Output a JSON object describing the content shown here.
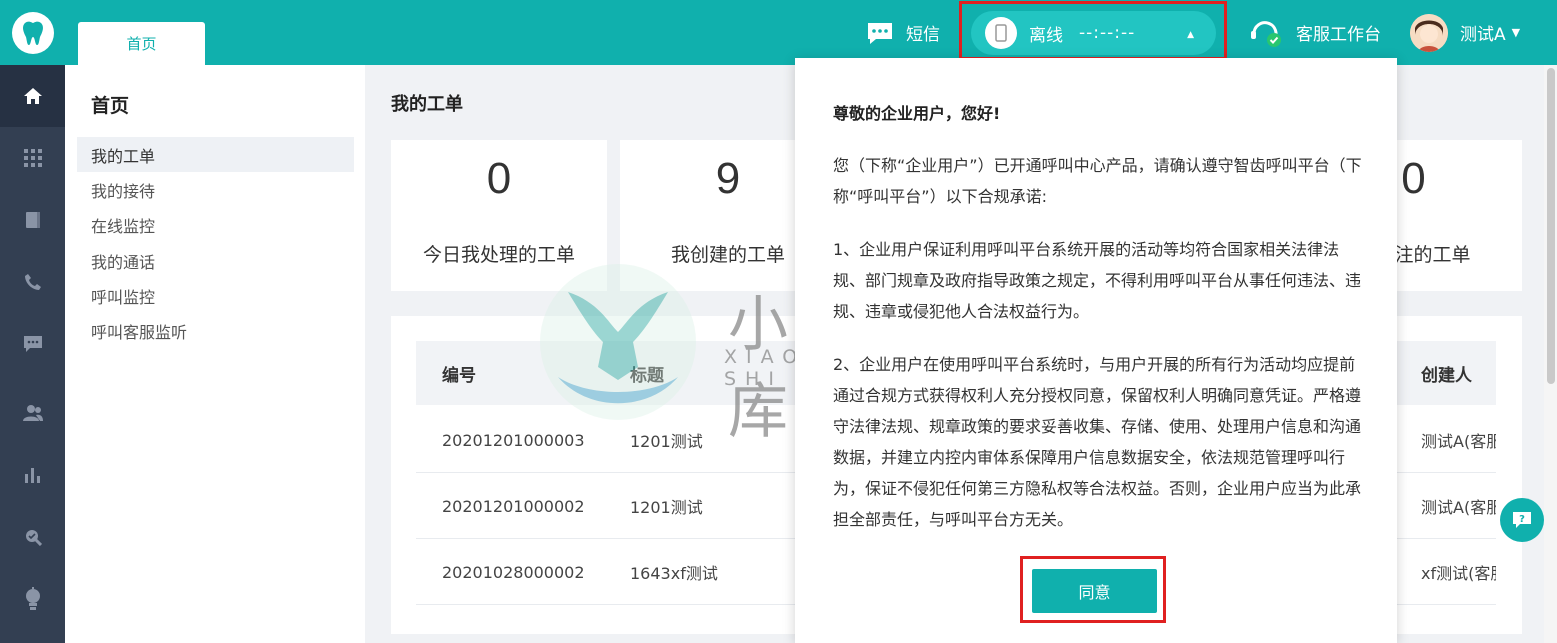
{
  "header": {
    "home_tab": "首页",
    "sms_label": "短信",
    "status_label": "离线",
    "status_time": "--:--:--",
    "workbench_label": "客服工作台",
    "user_name": "测试A"
  },
  "sidebar": {
    "title": "首页",
    "items": [
      "我的工单",
      "我的接待",
      "在线监控",
      "我的通话",
      "呼叫监控",
      "呼叫客服监听"
    ]
  },
  "main": {
    "title": "我的工单",
    "cards": [
      {
        "value": "0",
        "label": "今日我处理的工单"
      },
      {
        "value": "9",
        "label": "我创建的工单"
      },
      {
        "value": "0",
        "label": "我关注的工单"
      }
    ],
    "table": {
      "col_id": "编号",
      "col_title": "标题",
      "col_creator": "创建人",
      "rows": [
        {
          "id": "20201201000003",
          "title": "1201测试",
          "creator": "测试A(客服"
        },
        {
          "id": "20201201000002",
          "title": "1201测试",
          "creator": "测试A(客服"
        },
        {
          "id": "20201028000002",
          "title": "1643xf测试",
          "creator": "xf测试(客服"
        }
      ]
    }
  },
  "modal": {
    "title": "尊敬的企业用户，您好!",
    "p1": "您（下称“企业用户”）已开通呼叫中心产品，请确认遵守智齿呼叫平台（下称“呼叫平台”）以下合规承诺:",
    "p2": "1、企业用户保证利用呼叫平台系统开展的活动等均符合国家相关法律法规、部门规章及政府指导政策之规定，不得利用呼叫平台从事任何违法、违规、违章或侵犯他人合法权益行为。",
    "p3": "2、企业用户在使用呼叫平台系统时，与用户开展的所有行为活动均应提前通过合规方式获得权利人充分授权同意，保留权利人明确同意凭证。严格遵守法律法规、规章政策的要求妥善收集、存储、使用、处理用户信息和沟通数据，并建立内控内审体系保障用户信息数据安全，依法规范管理呼叫行为，保证不侵犯任何第三方隐私权等合法权益。否则，企业用户应当为此承担全部责任，与呼叫平台方无关。",
    "agree": "同意"
  },
  "watermark": {
    "text": "小牛知识库",
    "sub": "XIAO NIU ZHI SHI KU"
  },
  "colors": {
    "brand": "#10b0ad",
    "rail": "#333f52",
    "highlight": "#e02020"
  }
}
